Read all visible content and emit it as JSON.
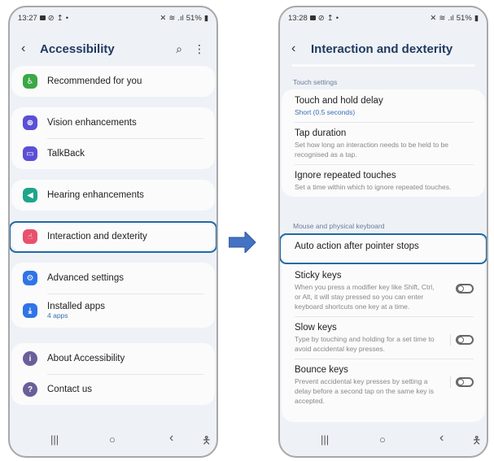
{
  "left_phone": {
    "status": {
      "time": "13:27",
      "battery": "51%"
    },
    "title": "Accessibility",
    "back_icon": "chevron-left-icon",
    "actions": [
      "search-icon",
      "more-vert-icon"
    ],
    "groups": [
      [
        {
          "label": "Recommended for you",
          "icon": "accessibility-icon",
          "color": "#3aa845"
        }
      ],
      [
        {
          "label": "Vision enhancements",
          "icon": "zoom-icon",
          "color": "#5b4fd6"
        },
        {
          "label": "TalkBack",
          "icon": "chat-icon",
          "color": "#5b4fd6"
        }
      ],
      [
        {
          "label": "Hearing enhancements",
          "icon": "speaker-icon",
          "color": "#1ea58a"
        }
      ],
      [
        {
          "label": "Interaction and dexterity",
          "icon": "touch-icon",
          "color": "#e8506e"
        }
      ],
      [
        {
          "label": "Advanced settings",
          "icon": "gear-plus-icon",
          "color": "#2f74e8"
        },
        {
          "label": "Installed apps",
          "sub": "4 apps",
          "icon": "download-icon",
          "color": "#2f74e8"
        }
      ],
      [
        {
          "label": "About Accessibility",
          "icon": "info-icon",
          "color": "#6b5f9a"
        },
        {
          "label": "Contact us",
          "icon": "help-icon",
          "color": "#6b5f9a"
        }
      ]
    ]
  },
  "right_phone": {
    "status": {
      "time": "13:28",
      "battery": "51%"
    },
    "title": "Interaction and dexterity",
    "sections": {
      "touch": "Touch settings",
      "mouse": "Mouse and physical keyboard"
    },
    "touch_items": [
      {
        "title": "Touch and hold delay",
        "sub": "Short (0.5 seconds)"
      },
      {
        "title": "Tap duration",
        "sub": "Set how long an interaction needs to be held to be recognised as a tap."
      },
      {
        "title": "Ignore repeated touches",
        "sub": "Set a time within which to ignore repeated touches."
      }
    ],
    "auto_action": "Auto action after pointer stops",
    "keyboard_items": [
      {
        "title": "Sticky keys",
        "sub": "When you press a modifier key like Shift, Ctrl, or Alt, it will stay pressed so you can enter keyboard shortcuts one key at a time.",
        "enabled": false
      },
      {
        "title": "Slow keys",
        "sub": "Type by touching and holding for a set time to avoid accidental key presses.",
        "enabled": false
      },
      {
        "title": "Bounce keys",
        "sub": "Prevent accidental key presses by setting a delay before a second tap on the same key is accepted.",
        "enabled": false
      }
    ]
  },
  "navbar": {
    "recents": "|||",
    "home": "○",
    "back": "‹",
    "accessibility": "✝"
  },
  "colors": {
    "highlight": "#1f6aa5",
    "arrow": "#4472c4",
    "title": "#1f3a5f"
  }
}
